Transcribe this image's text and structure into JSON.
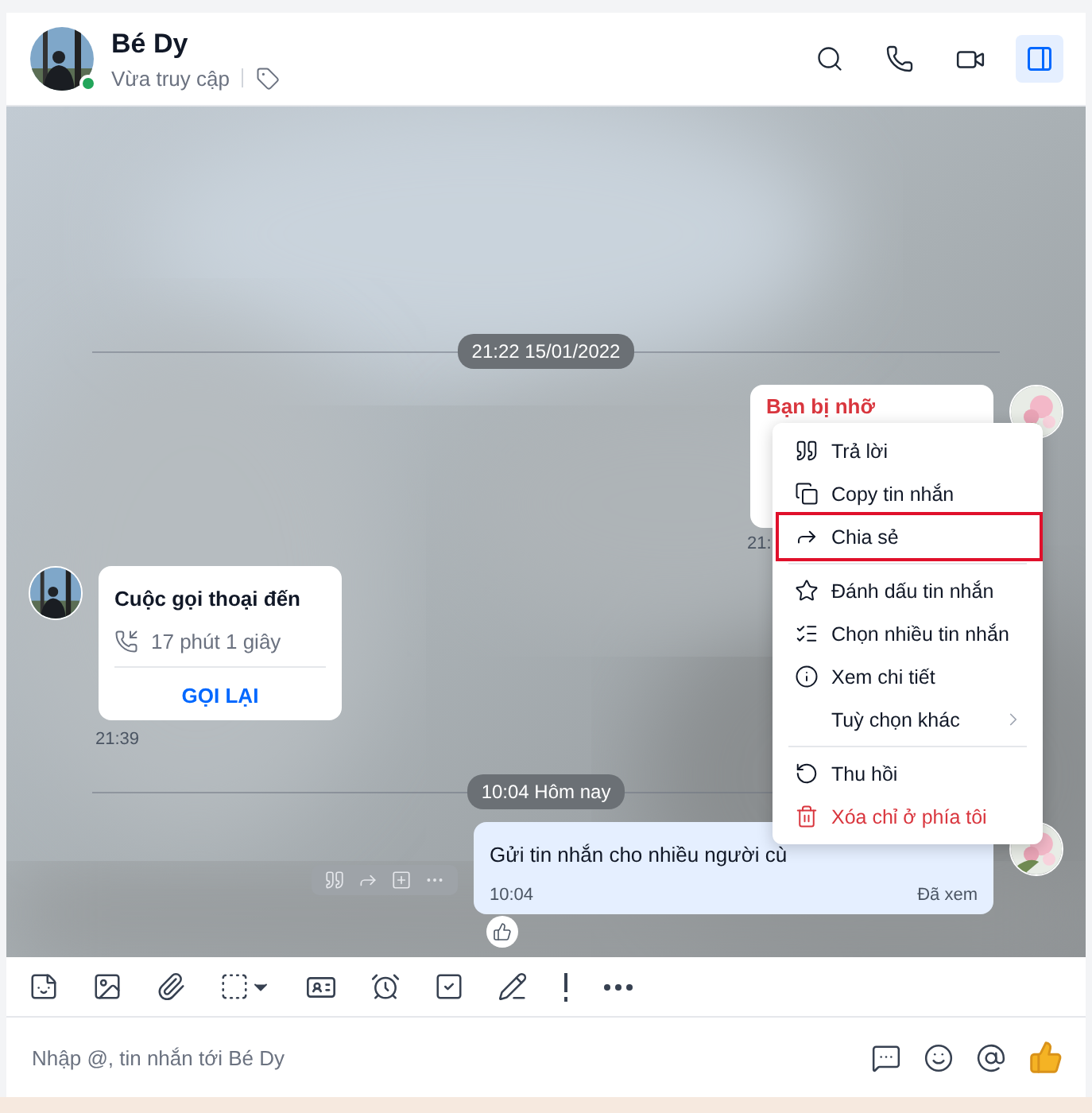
{
  "contact": {
    "name": "Bé Dy",
    "status": "Vừa truy cập",
    "online": true
  },
  "header": {
    "panel_open": true
  },
  "messages": [
    {
      "kind": "date",
      "text": "21:22 15/01/2022"
    },
    {
      "kind": "missed",
      "title": "Bạn bị nhỡ",
      "time": "21:"
    },
    {
      "kind": "call",
      "title": "Cuộc gọi thoại đến",
      "duration": "17 phút 1 giây",
      "action": "GỌI LẠI",
      "time": "21:39"
    },
    {
      "kind": "date",
      "text": "10:04 Hôm nay"
    },
    {
      "kind": "text",
      "text": "Gửi tin nhắn cho nhiều người cù",
      "time": "10:04",
      "status": "Đã xem",
      "liked": false
    }
  ],
  "context_menu": [
    {
      "kind": "reply",
      "label": "Trả lời",
      "selected": false
    },
    {
      "kind": "copy",
      "label": "Copy tin nhắn",
      "selected": false
    },
    {
      "kind": "share",
      "label": "Chia sẻ",
      "selected": true
    },
    {
      "kind": "divider"
    },
    {
      "kind": "star",
      "label": "Đánh dấu tin nhắn",
      "selected": false
    },
    {
      "kind": "multi",
      "label": "Chọn nhiều tin nhắn",
      "selected": false
    },
    {
      "kind": "info",
      "label": "Xem chi tiết",
      "selected": false
    },
    {
      "kind": "more",
      "label": "Tuỳ chọn khác",
      "selected": false
    },
    {
      "kind": "divider"
    },
    {
      "kind": "recall",
      "label": "Thu hồi",
      "selected": false
    },
    {
      "kind": "delete",
      "label": "Xóa chỉ ở phía tôi",
      "selected": false
    }
  ],
  "composer": {
    "placeholder": "Nhập @, tin nhắn tới Bé Dy"
  }
}
